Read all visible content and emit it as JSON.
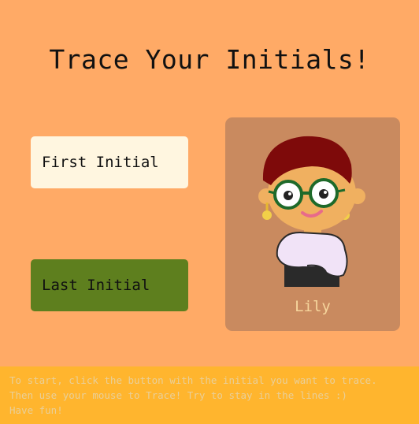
{
  "title": "Trace Your Initials!",
  "buttons": {
    "first": "First Initial",
    "last": "Last Initial"
  },
  "character": {
    "name": "Lily"
  },
  "instructions": [
    "To start, click the button with the initial you want to trace.",
    "Then use your mouse to Trace! Try to stay in the lines :)",
    "Have fun!"
  ],
  "colors": {
    "background": "#FFAA66",
    "first_button": "#FFF6E0",
    "last_button": "#5E7F1E",
    "card": "#C98A5F",
    "footer": "#FFB52E"
  }
}
